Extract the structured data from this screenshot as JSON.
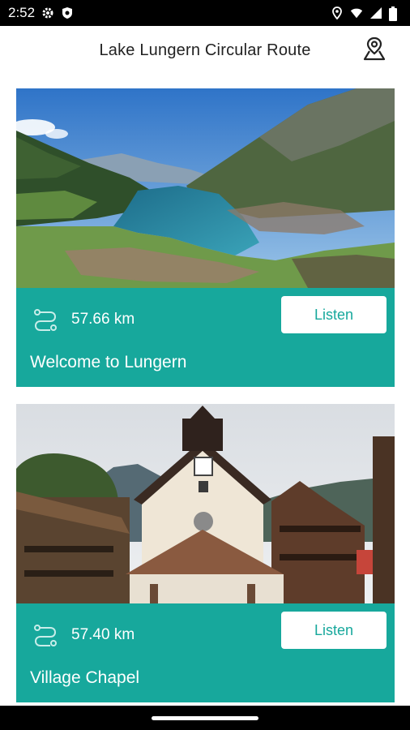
{
  "status_bar": {
    "time": "2:52",
    "left_icons": [
      "gear-icon",
      "shield-icon"
    ],
    "right_icons": [
      "location-icon",
      "wifi-icon",
      "signal-icon",
      "battery-icon"
    ]
  },
  "header": {
    "title": "Lake Lungern Circular Route",
    "action_icon": "map-pin-icon"
  },
  "colors": {
    "accent": "#17a89c",
    "header_bg": "#ffffff",
    "status_bar_bg": "#000000"
  },
  "cards": [
    {
      "distance": "57.66 km",
      "listen_label": "Listen",
      "title": "Welcome to Lungern",
      "image": "lake-lungern-valley-photo"
    },
    {
      "distance": "57.40 km",
      "listen_label": "Listen",
      "title": "Village Chapel",
      "image": "village-chapel-photo"
    }
  ]
}
